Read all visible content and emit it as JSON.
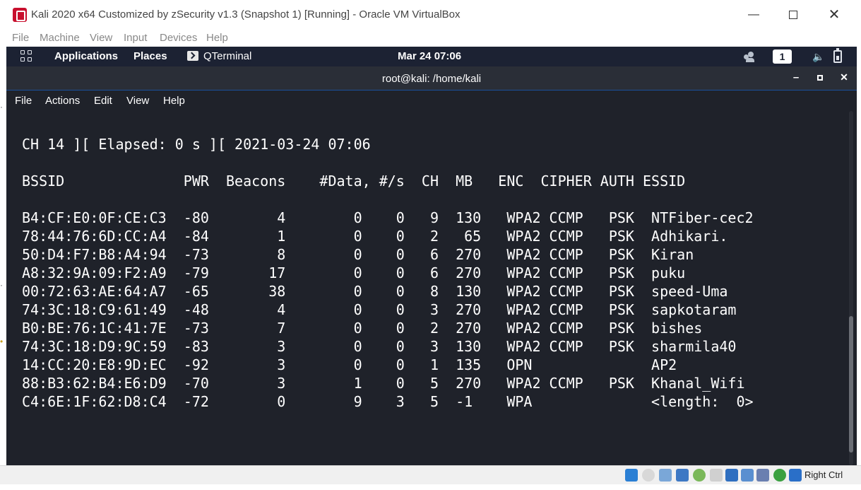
{
  "vbox": {
    "title": "Kali 2020 x64 Customized by zSecurity v1.3 (Snapshot 1) [Running] - Oracle VM VirtualBox",
    "minimize": "—",
    "close": "✕",
    "menu": [
      "File",
      "Machine",
      "View",
      "Input",
      "Devices",
      "Help"
    ],
    "host_key": "Right Ctrl"
  },
  "kali_panel": {
    "applications": "Applications",
    "places": "Places",
    "qterminal": "QTerminal",
    "clock": "Mar 24  07:06",
    "workspace": "1"
  },
  "terminal": {
    "title": "root@kali: /home/kali",
    "menu": [
      "File",
      "Actions",
      "Edit",
      "View",
      "Help"
    ],
    "header_line": "CH 14 ][ Elapsed: 0 s ][ 2021-03-24 07:06",
    "columns_line": "BSSID              PWR  Beacons    #Data, #/s  CH  MB   ENC  CIPHER AUTH ESSID",
    "rows": [
      "B4:CF:E0:0F:CE:C3  -80        4        0    0   9  130   WPA2 CCMP   PSK  NTFiber-cec2",
      "78:44:76:6D:CC:A4  -84        1        0    0   2   65   WPA2 CCMP   PSK  Adhikari.",
      "50:D4:F7:B8:A4:94  -73        8        0    0   6  270   WPA2 CCMP   PSK  Kiran",
      "A8:32:9A:09:F2:A9  -79       17        0    0   6  270   WPA2 CCMP   PSK  puku",
      "00:72:63:AE:64:A7  -65       38        0    0   8  130   WPA2 CCMP   PSK  speed-Uma",
      "74:3C:18:C9:61:49  -48        4        0    0   3  270   WPA2 CCMP   PSK  sapkotaram",
      "B0:BE:76:1C:41:7E  -73        7        0    0   2  270   WPA2 CCMP   PSK  bishes",
      "74:3C:18:D9:9C:59  -83        3        0    0   3  130   WPA2 CCMP   PSK  sharmila40",
      "14:CC:20:E8:9D:EC  -92        3        0    0   1  135   OPN              AP2",
      "88:B3:62:B4:E6:D9  -70        3        1    0   5  270   WPA2 CCMP   PSK  Khanal_Wifi",
      "C4:6E:1F:62:D8:C4  -72        0        9    3   5  -1    WPA              <length:  0>"
    ]
  },
  "colors": {
    "terminal_bg": "#1f222a",
    "panel_bg": "#1c2233",
    "accent": "#1a4f9a",
    "vbox_brand": "#c8102e"
  },
  "icons": {
    "app": "virtualbox-kali-icon",
    "grid": "applications-grid-icon",
    "terminal": "qterminal-icon",
    "people": "people-icon",
    "volume": "volume-muted-icon",
    "battery": "battery-icon"
  }
}
